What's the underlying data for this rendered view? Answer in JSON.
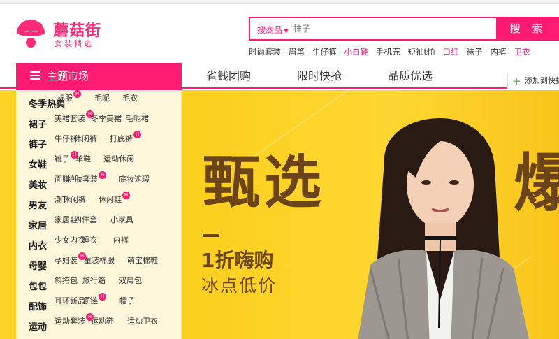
{
  "brand": {
    "name": "蘑菇街",
    "slogan": "女装精选",
    "color": "#ff2a78"
  },
  "search": {
    "scope": "搜商品",
    "placeholder": "袜子",
    "button": "搜 索",
    "hotwords": [
      {
        "text": "时尚套装",
        "highlight": false
      },
      {
        "text": "眉笔",
        "highlight": false
      },
      {
        "text": "牛仔裤",
        "highlight": false
      },
      {
        "text": "小白鞋",
        "highlight": true
      },
      {
        "text": "手机壳",
        "highlight": false
      },
      {
        "text": "短袖t恤",
        "highlight": false
      },
      {
        "text": "口红",
        "highlight": true
      },
      {
        "text": "袜子",
        "highlight": false
      },
      {
        "text": "内裤",
        "highlight": false
      },
      {
        "text": "卫衣",
        "highlight": true
      }
    ]
  },
  "nav": {
    "category_label": "主题市场",
    "tabs": [
      "省钱团购",
      "限时快抢",
      "品质优选"
    ],
    "favorite": "添加到快捷"
  },
  "categories": [
    {
      "title": "冬季热卖",
      "links": [
        {
          "text": "棉服",
          "hot": true
        },
        {
          "text": "毛呢",
          "hot": false
        },
        {
          "text": "毛衣",
          "hot": false
        }
      ]
    },
    {
      "title": "裙子",
      "links": [
        {
          "text": "美裙套装",
          "hot": true
        },
        {
          "text": "冬季美裙",
          "hot": false
        },
        {
          "text": "毛呢裙",
          "hot": false
        }
      ]
    },
    {
      "title": "裤子",
      "links": [
        {
          "text": "牛仔裤",
          "hot": false
        },
        {
          "text": "休闲裤",
          "hot": false
        },
        {
          "text": "打底裤",
          "hot": true
        }
      ]
    },
    {
      "title": "女鞋",
      "links": [
        {
          "text": "靴子",
          "hot": true
        },
        {
          "text": "单鞋",
          "hot": false
        },
        {
          "text": "运动休闲",
          "hot": false
        }
      ]
    },
    {
      "title": "美妆",
      "links": [
        {
          "text": "面膜",
          "hot": false
        },
        {
          "text": "护肤套装",
          "hot": true
        },
        {
          "text": "底妆遮瑕",
          "hot": false
        }
      ]
    },
    {
      "title": "男友",
      "links": [
        {
          "text": "潮T",
          "hot": false
        },
        {
          "text": "休闲裤",
          "hot": false
        },
        {
          "text": "休闲鞋",
          "hot": true
        }
      ]
    },
    {
      "title": "家居",
      "links": [
        {
          "text": "家居鞋",
          "hot": false
        },
        {
          "text": "四件套",
          "hot": false
        },
        {
          "text": "小家具",
          "hot": false
        }
      ]
    },
    {
      "title": "内衣",
      "links": [
        {
          "text": "少女内衣",
          "hot": false
        },
        {
          "text": "睡衣",
          "hot": false
        },
        {
          "text": "内裤",
          "hot": false
        }
      ]
    },
    {
      "title": "母婴",
      "links": [
        {
          "text": "孕妇装",
          "hot": true
        },
        {
          "text": "童装棉服",
          "hot": false
        },
        {
          "text": "萌宝棉鞋",
          "hot": false
        }
      ]
    },
    {
      "title": "包包",
      "links": [
        {
          "text": "斜挎包",
          "hot": false
        },
        {
          "text": "旅行箱",
          "hot": false
        },
        {
          "text": "双肩包",
          "hot": false
        }
      ]
    },
    {
      "title": "配饰",
      "links": [
        {
          "text": "耳环新品",
          "hot": false
        },
        {
          "text": "项链",
          "hot": true
        },
        {
          "text": "帽子",
          "hot": false
        }
      ]
    },
    {
      "title": "运动",
      "links": [
        {
          "text": "运动套装",
          "hot": true
        },
        {
          "text": "运动鞋",
          "hot": false
        },
        {
          "text": "运动卫衣",
          "hot": false
        }
      ]
    }
  ],
  "banner": {
    "title": "甄选",
    "title_partial": "爆",
    "subtitle1": "1折嗨购",
    "subtitle2": "冰点低价",
    "background": "#fcd324",
    "text_color": "#6b4419"
  }
}
